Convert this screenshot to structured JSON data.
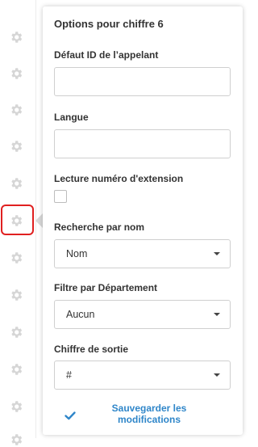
{
  "panel": {
    "title": "Options pour chiffre 6",
    "fields": {
      "caller_id_label": "Défaut ID de l’appelant",
      "caller_id_value": "",
      "language_label": "Langue",
      "language_value": "",
      "ext_reading_label": "Lecture numéro d'extension",
      "ext_reading_checked": false,
      "name_search_label": "Recherche par nom",
      "name_search_value": "Nom",
      "department_filter_label": "Filtre par Département",
      "department_filter_value": "Aucun",
      "exit_digit_label": "Chiffre de sortie",
      "exit_digit_value": "#"
    },
    "save_button_label": "Sauvegarder les modifications"
  },
  "sidebar": {
    "gear_icon_count": 12,
    "selected_index": 6
  },
  "colors": {
    "accent": "#2f86c9",
    "highlight": "#e02020",
    "gear": "#d6d6d6"
  }
}
